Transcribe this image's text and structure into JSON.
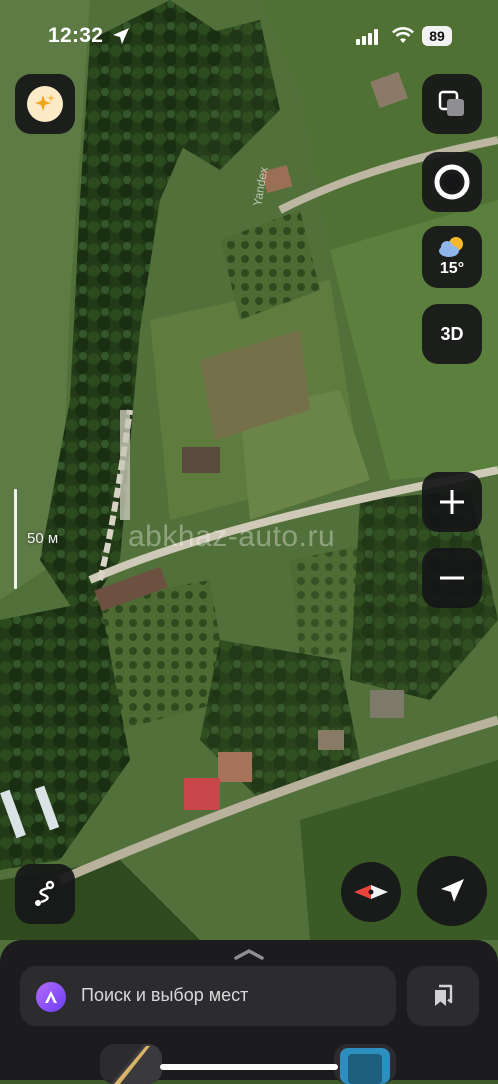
{
  "status_bar": {
    "time": "12:32",
    "battery": "89",
    "icons": [
      "location-arrow-icon",
      "signal-icon",
      "wifi-icon",
      "battery-icon"
    ]
  },
  "map": {
    "type": "satellite",
    "scale_label": "50 м",
    "attribution": "Yandex",
    "watermark": "abkhaz-auto.ru"
  },
  "controls": {
    "assistant_icon": "sparkles-icon",
    "layers_icon": "layers-icon",
    "traffic_icon": "traffic-ring-icon",
    "weather": {
      "icon": "partly-cloudy-icon",
      "temperature": "15°"
    },
    "view_3d_label": "3D",
    "zoom_in_label": "+",
    "zoom_out_label": "−",
    "route_icon": "route-icon",
    "compass_icon": "compass-icon",
    "locate_icon": "navigation-arrow-icon"
  },
  "bottom_sheet": {
    "search_placeholder": "Поиск и выбор мест",
    "voice_assistant_icon": "alice-icon",
    "bookmarks_icon": "bookmarks-icon"
  },
  "colors": {
    "control_bg": "#161618",
    "sheet_bg": "#1c1c1e",
    "search_bg": "#2c2c2e",
    "alice_accent": "#8a4dff",
    "compass_red": "#e8453c"
  }
}
